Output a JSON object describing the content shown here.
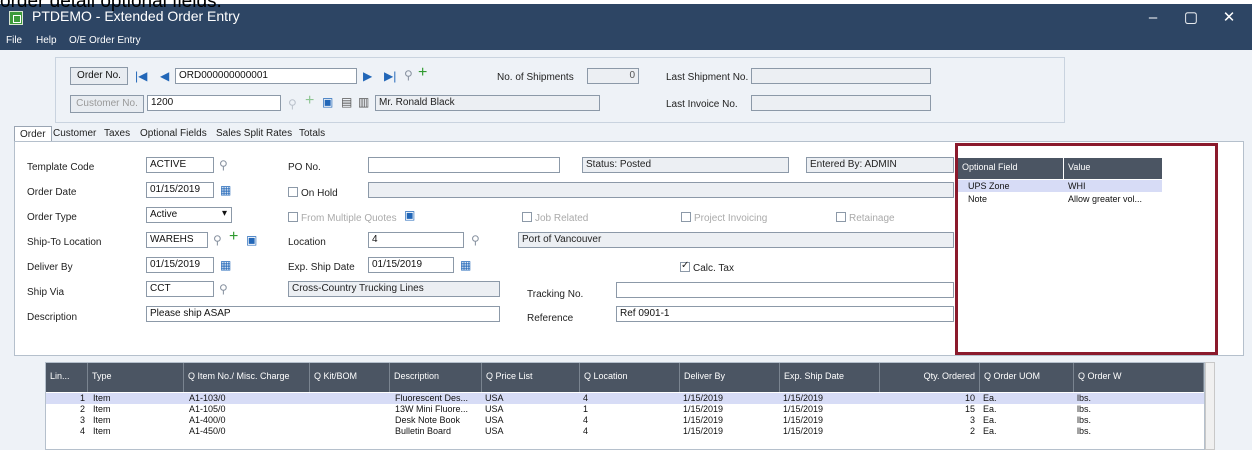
{
  "caption": "order detail optional fields.",
  "window": {
    "title": "PTDEMO - Extended Order Entry",
    "controls": {
      "minimize": "–",
      "maximize": "▢",
      "close": "✕"
    }
  },
  "menu": [
    "File",
    "Help",
    "O/E Order Entry"
  ],
  "header": {
    "order_no_button": "Order No.",
    "order_no": "ORD000000000001",
    "customer_no_button": "Customer No.",
    "customer_no": "1200",
    "customer_name": "Mr. Ronald Black",
    "shipments_label": "No. of Shipments",
    "shipments": "0",
    "last_shipment_label": "Last Shipment No.",
    "last_shipment": "",
    "last_invoice_label": "Last Invoice No.",
    "last_invoice": ""
  },
  "tabs": [
    "Order",
    "Customer",
    "Taxes",
    "Optional Fields",
    "Sales Split",
    "Rates",
    "Totals"
  ],
  "form": {
    "template_code_label": "Template Code",
    "template_code": "ACTIVE",
    "po_label": "PO No.",
    "po": "",
    "status": "Status: Posted",
    "entered_by": "Entered By: ADMIN",
    "order_date_label": "Order Date",
    "order_date": "01/15/2019",
    "on_hold_label": "On Hold",
    "order_type_label": "Order Type",
    "order_type": "Active",
    "from_multiple_quotes": "From Multiple Quotes",
    "job_related": "Job Related",
    "project_invoicing": "Project Invoicing",
    "retainage": "Retainage",
    "ship_to_label": "Ship-To Location",
    "ship_to": "WAREHS",
    "location_label": "Location",
    "location": "4",
    "location_desc": "Port of Vancouver",
    "deliver_by_label": "Deliver By",
    "deliver_by": "01/15/2019",
    "exp_ship_label": "Exp. Ship Date",
    "exp_ship": "01/15/2019",
    "calc_tax": "Calc. Tax",
    "ship_via_label": "Ship Via",
    "ship_via": "CCT",
    "ship_via_desc": "Cross-Country Trucking Lines",
    "tracking_label": "Tracking No.",
    "tracking": "",
    "description_label": "Description",
    "description": "Please ship ASAP",
    "reference_label": "Reference",
    "reference": "Ref 0901-1"
  },
  "optional_fields": {
    "headers": [
      "Optional Field",
      "Value"
    ],
    "rows": [
      {
        "field": "UPS Zone",
        "value": "WHI"
      },
      {
        "field": "Note",
        "value": "Allow greater vol..."
      }
    ]
  },
  "grid": {
    "headers": [
      "Lin...",
      "Type",
      "Q Item No./ Misc. Charge",
      "Q Kit/BOM",
      "Description",
      "Q Price List",
      "Q Location",
      "Deliver By",
      "Exp. Ship Date",
      "Qty. Ordered",
      "Q Order UOM",
      "Q Order W"
    ],
    "rows": [
      [
        "1",
        "Item",
        "A1-103/0",
        "",
        "Fluorescent Des...",
        "USA",
        "4",
        "1/15/2019",
        "1/15/2019",
        "10",
        "Ea.",
        "lbs."
      ],
      [
        "2",
        "Item",
        "A1-105/0",
        "",
        "13W Mini Fluore...",
        "USA",
        "1",
        "1/15/2019",
        "1/15/2019",
        "15",
        "Ea.",
        "lbs."
      ],
      [
        "3",
        "Item",
        "A1-400/0",
        "",
        "Desk Note Book",
        "USA",
        "4",
        "1/15/2019",
        "1/15/2019",
        "3",
        "Ea.",
        "lbs."
      ],
      [
        "4",
        "Item",
        "A1-450/0",
        "",
        "Bulletin Board",
        "USA",
        "4",
        "1/15/2019",
        "1/15/2019",
        "2",
        "Ea.",
        "lbs."
      ]
    ]
  }
}
